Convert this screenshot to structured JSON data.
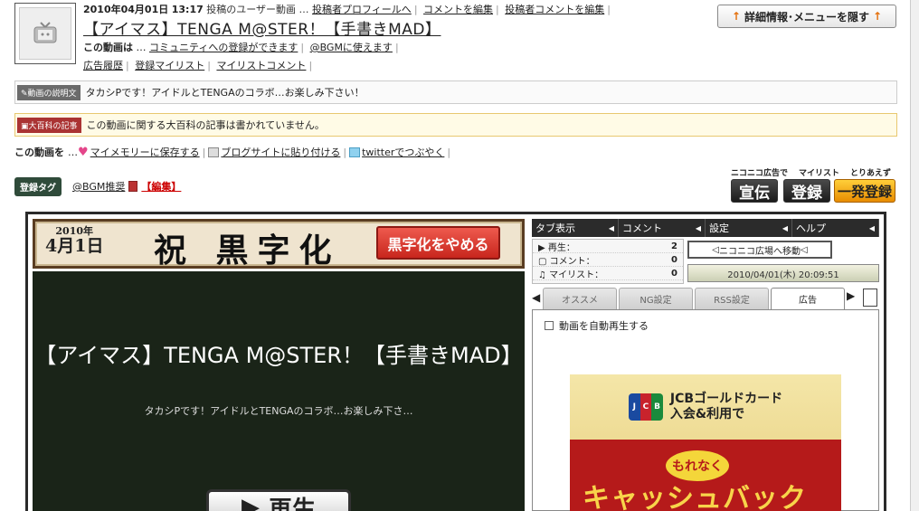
{
  "header": {
    "date": "2010年04月01日",
    "time": "13:17",
    "kind": "投稿のユーザー動画",
    "ellipsis": "…",
    "link_profile": "投稿者プロフィールへ",
    "link_edit_comment": "コメントを編集",
    "link_edit_uploader_comment": "投稿者コメントを編集",
    "title": "【アイマス】TENGA M@STER！【手書きMAD】",
    "info_label": "この動画は",
    "info_community": "コミュニティへの登録ができます",
    "info_bgm": "@BGMに使えます",
    "link_ad_history": "広告履歴",
    "link_mylist_reg": "登録マイリスト",
    "link_mylist_comment": "マイリストコメント",
    "hide_button": "詳細情報･メニューを隠す",
    "hide_arrow": "↑"
  },
  "description": {
    "label": "動画の説明文",
    "text": "タカシPです！アイドルとTENGAのコラボ…お楽しみ下さい！"
  },
  "dictionary": {
    "label": "大百科の記事",
    "text": "この動画に関する大百科の記事は書かれていません。"
  },
  "share": {
    "label": "この動画を",
    "ellipsis": "…",
    "memory": "マイメモリーに保存する",
    "blog": "ブログサイトに貼り付ける",
    "twitter": "twitterでつぶやく"
  },
  "tags": {
    "label": "登録タグ",
    "items": [
      "@BGM推奨"
    ],
    "edit": "【編集】"
  },
  "ad_buttons": {
    "label_ad": "ニコニコ広告で",
    "label_mylist": "マイリスト",
    "label_quick": "とりあえず",
    "ad": "宣伝",
    "mylist": "登録",
    "quick": "一発登録"
  },
  "player": {
    "banner_year": "2010年",
    "banner_date": "4月1日",
    "banner_main": "祝 黒字化",
    "stop_button": "黒字化をやめる",
    "screen_title": "【アイマス】TENGA M@STER！【手書きMAD】",
    "screen_sub": "タカシPです！アイドルとTENGAのコラボ…お楽しみ下さ…",
    "play_icon": "▶",
    "play_label": "再生",
    "tabs": [
      "タブ表示",
      "コメント",
      "設定",
      "ヘルプ"
    ],
    "stats": [
      {
        "label": "再生：",
        "value": "2"
      },
      {
        "label": "コメント：",
        "value": "0"
      },
      {
        "label": "マイリスト：",
        "value": "0"
      }
    ],
    "plaza_button": "ニコニコ広場へ移動",
    "datetime": "2010/04/01(木) 20:09:51",
    "subtabs": [
      "オススメ",
      "NG設定",
      "RSS設定",
      "広告"
    ],
    "autoplay_label": "動画を自動再生する"
  },
  "ad": {
    "logo": [
      "J",
      "C",
      "B"
    ],
    "line1": "JCBゴールドカード",
    "line2": "入会&利用で",
    "badge": "もれなく",
    "cash": "キャッシュバック"
  },
  "colors": {
    "stop_button": "#d8332a",
    "tag_label": "#2f4b3a",
    "quick_button": "#f3a617",
    "screen": "#1a2418"
  }
}
